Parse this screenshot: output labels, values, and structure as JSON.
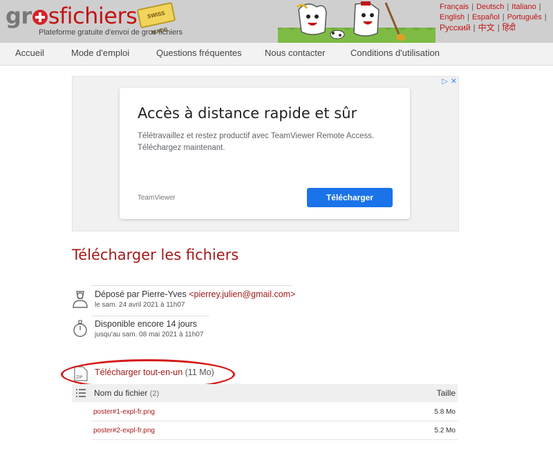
{
  "header": {
    "logo_gr": "gr",
    "logo_rest": "sfichiers",
    "badge": "SWISS MADE",
    "tagline": "Plateforme gratuite d'envoi de gros fichiers",
    "languages": {
      "row1": [
        "Français",
        "Deutsch",
        "Italiano"
      ],
      "row2": [
        "English",
        "Español",
        "Português"
      ],
      "row3": [
        "Русский",
        "中文",
        "हिंदी"
      ]
    }
  },
  "nav": {
    "items": [
      "Accueil",
      "Mode d'emploi",
      "Questions fréquentes",
      "Nous contacter",
      "Conditions d'utilisation"
    ]
  },
  "ad": {
    "title": "Accès à distance rapide et sûr",
    "text": "Télétravaillez et restez productif avec TeamViewer Remote Access. Téléchargez maintenant.",
    "brand": "TeamViewer",
    "button": "Télécharger",
    "icons": [
      "ad-choices-icon",
      "close-icon"
    ]
  },
  "main": {
    "title": "Télécharger les fichiers",
    "deposit": {
      "prefix": "Déposé par Pierre-Yves ",
      "email": "<pierrey.julien@gmail.com>",
      "date": "le sam. 24 avril 2021 à 11h07"
    },
    "availability": {
      "text": "Disponible encore 14 jours",
      "until": "jusqu'au sam. 08 mai 2021 à 11h07"
    },
    "download_all": {
      "label": "Télécharger tout-en-un",
      "size": "(11 Mo)"
    },
    "table": {
      "col_name": "Nom du fichier",
      "count": "(2)",
      "col_size": "Taille",
      "rows": [
        {
          "name": "poster#1-expl-fr.png",
          "size": "5.8 Mo"
        },
        {
          "name": "poster#2-expl-fr.png",
          "size": "5.2 Mo"
        }
      ]
    }
  },
  "colors": {
    "brand_red": "#a31818",
    "annotation_red": "#d31a1a",
    "ad_button": "#1a73e8"
  }
}
